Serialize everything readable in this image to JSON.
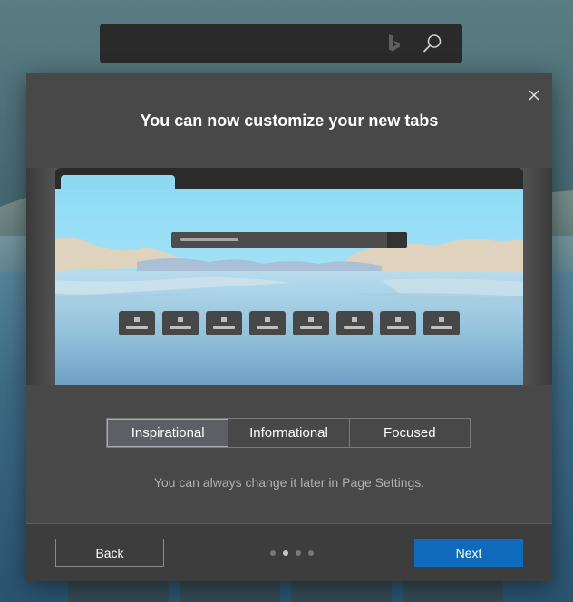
{
  "dialog": {
    "title": "You can now customize your new tabs",
    "close_icon": "close-icon",
    "layout_options": [
      {
        "label": "Inspirational",
        "selected": true
      },
      {
        "label": "Informational",
        "selected": false
      },
      {
        "label": "Focused",
        "selected": false
      }
    ],
    "hint": "You can always change it later in Page Settings.",
    "back_label": "Back",
    "next_label": "Next",
    "pager": {
      "current": 2,
      "total": 4
    }
  },
  "search_bar": {
    "icons": [
      "bing-icon",
      "search-icon"
    ]
  },
  "colors": {
    "accent": "#0f6cbd",
    "dialog_bg": "#484848",
    "footer_bg": "#3d3d3d"
  }
}
